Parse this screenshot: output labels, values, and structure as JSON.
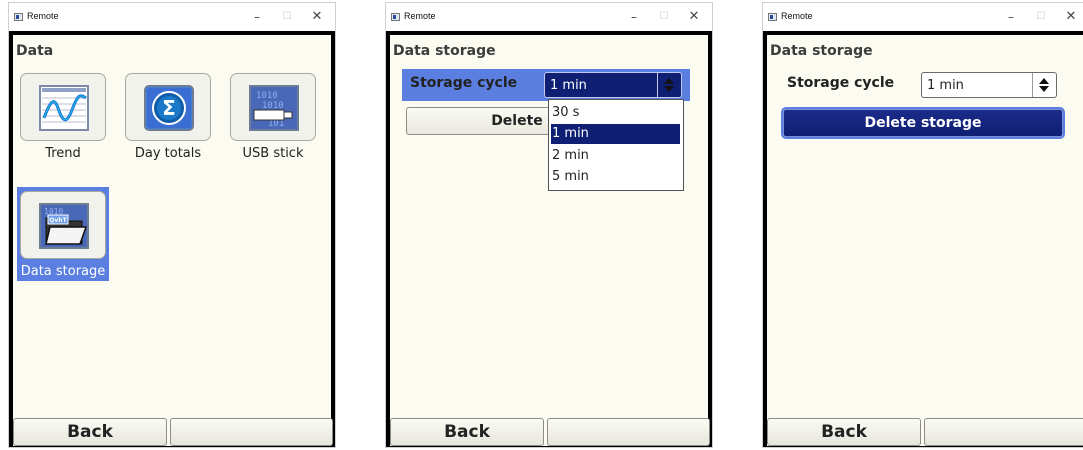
{
  "windows": [
    {
      "title": "Remote",
      "screen_title": "Data",
      "tiles": [
        {
          "label": "Trend",
          "icon": "trend-chart-icon",
          "selected": false
        },
        {
          "label": "Day totals",
          "icon": "sigma-icon",
          "selected": false
        },
        {
          "label": "USB stick",
          "icon": "usb-stick-icon",
          "selected": false
        },
        {
          "label": "Data storage",
          "icon": "data-storage-folder-icon",
          "selected": true
        }
      ],
      "softkeys": {
        "left": "Back",
        "right": ""
      }
    },
    {
      "title": "Remote",
      "screen_title": "Data storage",
      "storage_cycle_label": "Storage cycle",
      "storage_cycle_value": "1 min",
      "delete_button": "Delete s",
      "dropdown_open": true,
      "dropdown_options": [
        "30 s",
        "1 min",
        "2 min",
        "5 min"
      ],
      "dropdown_selected": "1 min",
      "softkeys": {
        "left": "Back",
        "right": ""
      }
    },
    {
      "title": "Remote",
      "screen_title": "Data storage",
      "storage_cycle_label": "Storage cycle",
      "storage_cycle_value": "1 min",
      "delete_button": "Delete storage",
      "softkeys": {
        "left": "Back",
        "right": ""
      }
    }
  ],
  "colors": {
    "selection_blue": "#5a7fe0",
    "dark_navy": "#0f1f73",
    "screen_bg": "#fbfbf2"
  }
}
